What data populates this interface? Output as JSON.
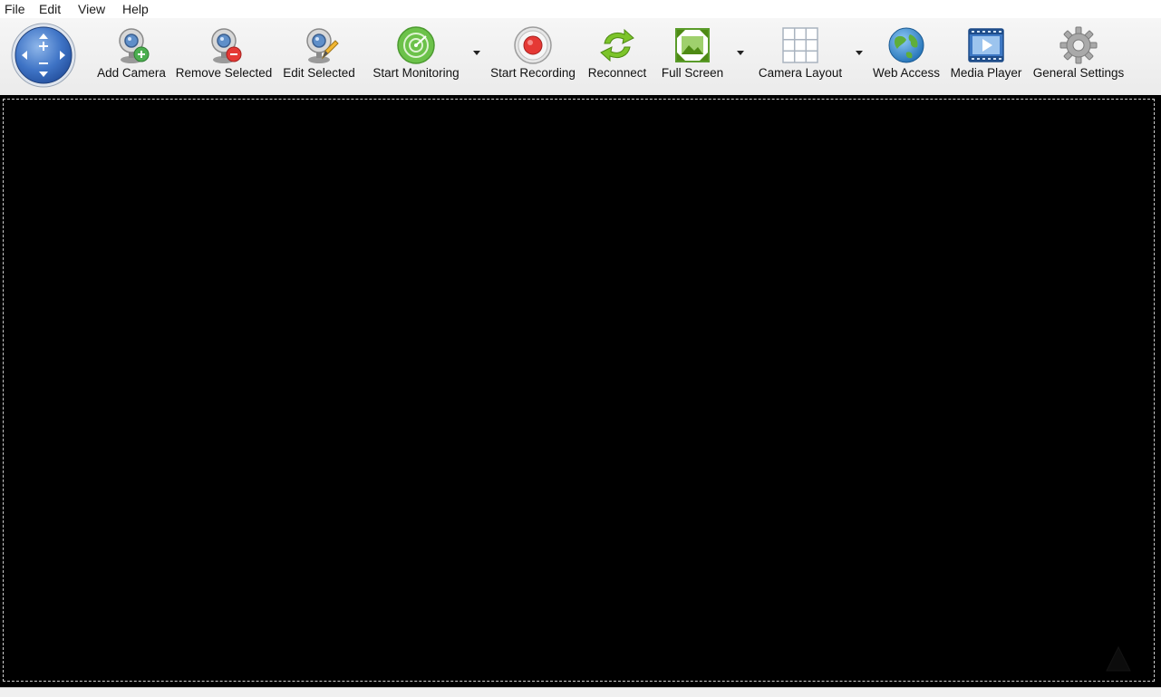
{
  "menu": {
    "file": "File",
    "edit": "Edit",
    "view": "View",
    "help": "Help"
  },
  "toolbar": {
    "ptz_control": "ptz-direction-pad",
    "buttons": {
      "add_camera": "Add Camera",
      "remove_selected": "Remove Selected",
      "edit_selected": "Edit Selected",
      "start_monitoring": "Start Monitoring",
      "start_recording": "Start Recording",
      "reconnect": "Reconnect",
      "full_screen": "Full Screen",
      "camera_layout": "Camera Layout",
      "web_access": "Web Access",
      "media_player": "Media Player",
      "general_settings": "General Settings"
    }
  },
  "colors": {
    "monitoring": "#6cc24a",
    "recording": "#e53935",
    "reconnect": "#7cc42a",
    "view_background": "#000000"
  }
}
